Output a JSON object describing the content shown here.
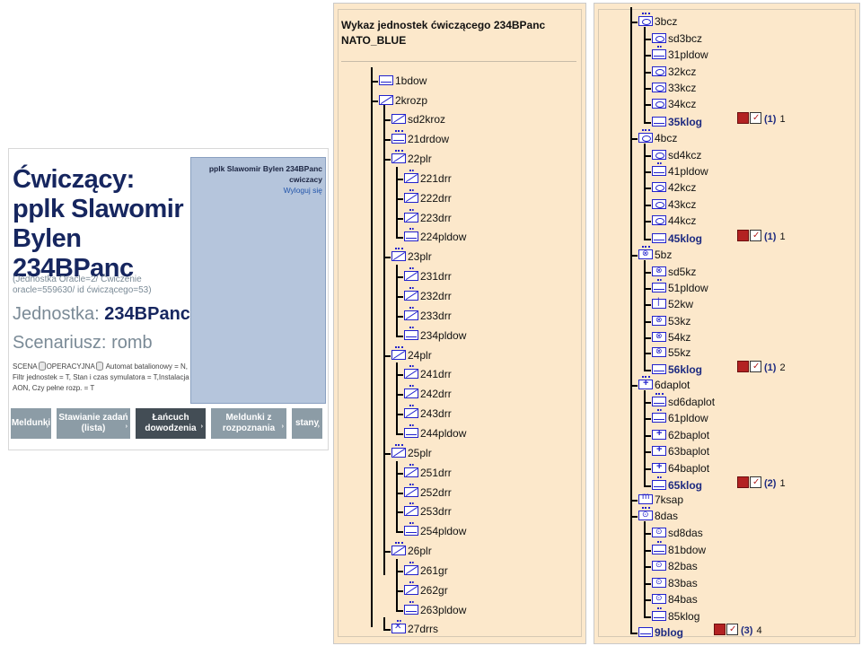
{
  "left_panel": {
    "title": "Ćwiczący: pplk Slawomir Bylen 234BPanc",
    "ids_line": "(Jednostka Oracle=2/ Ćwiczenie oracle=559630/ id ćwiczącego=53)",
    "unit_label": "Jednostka:",
    "unit_value": "234BPanc",
    "scenario_label": "Scenariusz:",
    "scenario_value": "romb",
    "scena_label": "SCENA",
    "operacyjna_label": "OPERACYJNA",
    "options_text": "Automat batalionowy = N, Filtr jednostek = T, Stan i czas symulatora = T,Instalacja = AON, Czy pełne rozp. = T",
    "user_name": "pplk Slawomir Bylen 234BPanc",
    "user_role": "cwiczacy",
    "logout_label": "Wyloguj się",
    "buttons": [
      {
        "label": "Meldunki"
      },
      {
        "label": "Stawianie zadań (lista)"
      },
      {
        "label": "Łańcuch dowodzenia"
      },
      {
        "label": "Meldunki z rozpoznania"
      },
      {
        "label": "stany"
      }
    ]
  },
  "middle_tree": {
    "header": "Wykaz jednostek ćwiczącego 234BPanc NATO_BLUE",
    "nodes": [
      {
        "label": "1bdow"
      },
      {
        "label": "2krozp"
      },
      {
        "label": "sd2kroz"
      },
      {
        "label": "21drdow"
      },
      {
        "label": "22plr"
      },
      {
        "label": "221drr"
      },
      {
        "label": "222drr"
      },
      {
        "label": "223drr"
      },
      {
        "label": "224pldow"
      },
      {
        "label": "23plr"
      },
      {
        "label": "231drr"
      },
      {
        "label": "232drr"
      },
      {
        "label": "233drr"
      },
      {
        "label": "234pldow"
      },
      {
        "label": "24plr"
      },
      {
        "label": "241drr"
      },
      {
        "label": "242drr"
      },
      {
        "label": "243drr"
      },
      {
        "label": "244pldow"
      },
      {
        "label": "25plr"
      },
      {
        "label": "251drr"
      },
      {
        "label": "252drr"
      },
      {
        "label": "253drr"
      },
      {
        "label": "254pldow"
      },
      {
        "label": "26plr"
      },
      {
        "label": "261gr"
      },
      {
        "label": "262gr"
      },
      {
        "label": "263pldow"
      },
      {
        "label": "27drrs"
      }
    ]
  },
  "right_tree": {
    "nodes": [
      {
        "label": "3bcz"
      },
      {
        "label": "sd3bcz"
      },
      {
        "label": "31pldow"
      },
      {
        "label": "32kcz"
      },
      {
        "label": "33kcz"
      },
      {
        "label": "34kcz"
      },
      {
        "label": "35klog",
        "count": "(1)",
        "num": "1"
      },
      {
        "label": "4bcz"
      },
      {
        "label": "sd4kcz"
      },
      {
        "label": "41pldow"
      },
      {
        "label": "42kcz"
      },
      {
        "label": "43kcz"
      },
      {
        "label": "44kcz"
      },
      {
        "label": "45klog",
        "count": "(1)",
        "num": "1"
      },
      {
        "label": "5bz"
      },
      {
        "label": "sd5kz"
      },
      {
        "label": "51pldow"
      },
      {
        "label": "52kw"
      },
      {
        "label": "53kz"
      },
      {
        "label": "54kz"
      },
      {
        "label": "55kz"
      },
      {
        "label": "56klog",
        "count": "(1)",
        "num": "2"
      },
      {
        "label": "6daplot"
      },
      {
        "label": "sd6daplot"
      },
      {
        "label": "61pldow"
      },
      {
        "label": "62baplot"
      },
      {
        "label": "63baplot"
      },
      {
        "label": "64baplot"
      },
      {
        "label": "65klog",
        "count": "(2)",
        "num": "1"
      },
      {
        "label": "7ksap"
      },
      {
        "label": "8das"
      },
      {
        "label": "sd8das"
      },
      {
        "label": "81bdow"
      },
      {
        "label": "82bas"
      },
      {
        "label": "83bas"
      },
      {
        "label": "84bas"
      },
      {
        "label": "85klog"
      },
      {
        "label": "9blog",
        "count": "(3)",
        "num": "4"
      }
    ]
  }
}
